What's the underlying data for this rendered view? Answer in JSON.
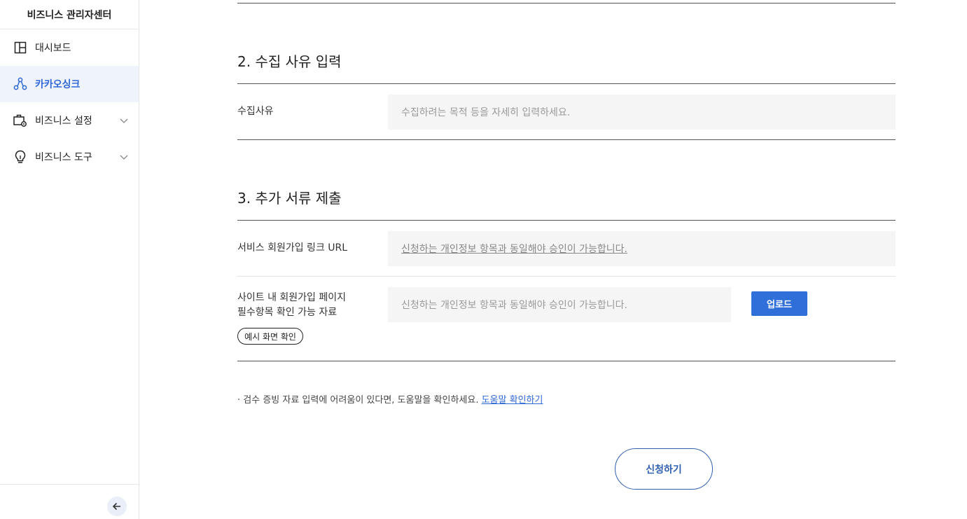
{
  "sidebar": {
    "title": "비즈니스 관리자센터",
    "items": [
      {
        "label": "대시보드",
        "icon": "dashboard-icon",
        "active": false,
        "expandable": false
      },
      {
        "label": "카카오싱크",
        "icon": "kakaosync-icon",
        "active": true,
        "expandable": false
      },
      {
        "label": "비즈니스 설정",
        "icon": "business-settings-icon",
        "active": false,
        "expandable": true
      },
      {
        "label": "비즈니스 도구",
        "icon": "lightbulb-icon",
        "active": false,
        "expandable": true
      }
    ],
    "collapse_icon": "arrow-left-icon"
  },
  "section2": {
    "title": "2. 수집 사유 입력",
    "reason_label": "수집사유",
    "reason_placeholder": "수집하려는 목적 등을 자세히 입력하세요."
  },
  "section3": {
    "title": "3. 추가 서류 제출",
    "url_label": "서비스 회원가입 링크 URL",
    "url_placeholder": "신청하는 개인정보 항목과 동일해야 승인이 가능합니다.",
    "file_label_line1": "사이트 내 회원가입 페이지",
    "file_label_line2": "필수항목 확인 가능 자료",
    "file_placeholder": "신청하는 개인정보 항목과 동일해야 승인이 가능합니다.",
    "upload_label": "업로드",
    "example_label": "예시 화면 확인"
  },
  "note": {
    "text": "· 검수 증빙 자료 입력에 어려움이 있다면, 도움말을 확인하세요. ",
    "link": "도움말 확인하기"
  },
  "submit_label": "신청하기",
  "colors": {
    "accent": "#2f67d8",
    "upload_button": "#2f6fd9",
    "active_bg": "#eef3fc",
    "input_bg": "#f5f5f5"
  }
}
